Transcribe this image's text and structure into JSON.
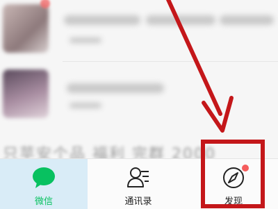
{
  "tabbar": {
    "tabs": [
      {
        "id": "chats",
        "label": "微信"
      },
      {
        "id": "contacts",
        "label": "通讯录"
      },
      {
        "id": "discover",
        "label": "发现"
      }
    ]
  },
  "chat_list": {
    "snippet": "只苹安个品 福利 完群 2000"
  },
  "annotation": {
    "color": "#c4171a"
  },
  "colors": {
    "wechat_green": "#08c160",
    "unread_dot": "#f55d5d",
    "selected_tab_bg": "#d9ecf7"
  },
  "icons": {
    "chats": "chat-bubble-icon",
    "contacts": "contacts-list-icon",
    "discover": "compass-icon"
  }
}
